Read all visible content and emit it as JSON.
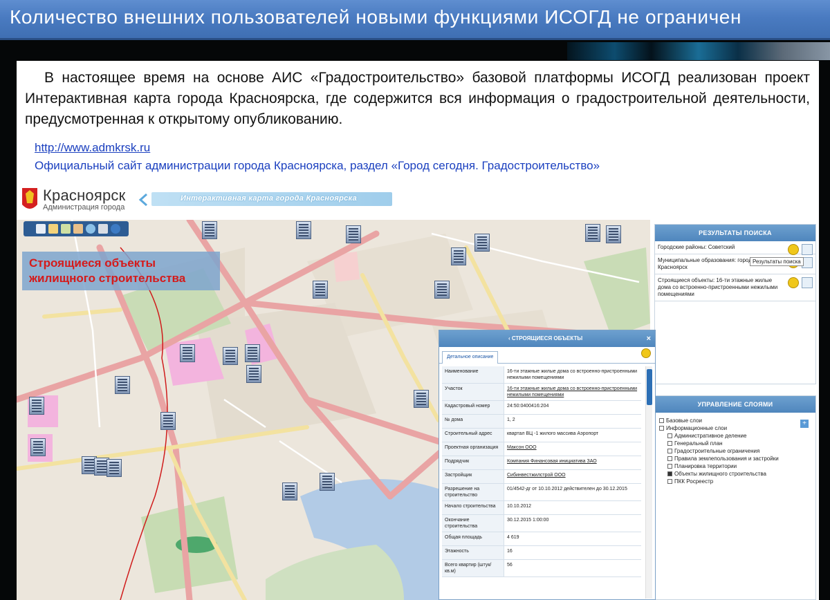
{
  "slide": {
    "title": "Количество внешних пользователей новыми функциями ИСОГД не ограничен",
    "paragraph": "В настоящее время на основе АИС «Градостроительство» базовой платформы ИСОГД реализован проект Интерактивная карта города Красноярска, где содержится вся информация о градостроительной деятельности, предусмотренная к открытому опубликованию.",
    "link_url": "http://www.admkrsk.ru",
    "link_desc": "Официальный сайт администрации города Красноярска, раздел «Город сегодня. Градостроительство»"
  },
  "app": {
    "brand_city": "Красноярск",
    "brand_sub": "Администрация города",
    "banner": "Интерактивная карта города Красноярска",
    "map_label_line1": "Строящиеся объекты",
    "map_label_line2": "жилищного строительства",
    "toolbar_icons": [
      "search-icon",
      "layers-icon",
      "edit-icon",
      "ruler-icon",
      "globe-icon",
      "print-icon",
      "help-icon"
    ]
  },
  "results": {
    "header": "РЕЗУЛЬТАТЫ ПОИСКА",
    "items": [
      "Городские районы: Советский",
      "Муниципальные образования: город Красноярск",
      "Строящиеся объекты: 16-ти этажные жилые дома со встроенно-пристроенными нежилыми помещениями"
    ],
    "tooltip": "Результаты поиска"
  },
  "objects": {
    "header": "СТРОЯЩИЕСЯ ОБЪЕКТЫ",
    "close": "×",
    "tab": "Детальное описание",
    "rows": [
      {
        "k": "Наименование",
        "v": "16-ти этажные жилые дома со встроенно-пристроенными нежилыми помещениями",
        "u": false
      },
      {
        "k": "Участок",
        "v": "16-ти этажные жилые дома со встроенно-пристроенными нежилыми помещениями",
        "u": true
      },
      {
        "k": "Кадастровый номер",
        "v": "24:50:0400416:204",
        "u": false
      },
      {
        "k": "№ дома",
        "v": "1, 2",
        "u": false
      },
      {
        "k": "Строительный адрес",
        "v": "квартал ВЦ -1 жилого массива Аэропорт",
        "u": false
      },
      {
        "k": "Проектная организация",
        "v": "Максон ООО",
        "u": true
      },
      {
        "k": "Подрядчик",
        "v": "Компания Финансовая инициатива ЗАО",
        "u": true
      },
      {
        "k": "Застройщик",
        "v": "Сибинвестжилстрой ООО",
        "u": true
      },
      {
        "k": "Разрешение на строительство",
        "v": "01/4542-дг от 10.10.2012 действителен до 30.12.2015",
        "u": false
      },
      {
        "k": "Начало строительства",
        "v": "10.10.2012",
        "u": false
      },
      {
        "k": "Окончание строительства",
        "v": "30.12.2015 1:00:00",
        "u": false
      },
      {
        "k": "Общая площадь",
        "v": "4 619",
        "u": false
      },
      {
        "k": "Этажность",
        "v": "16",
        "u": false
      },
      {
        "k": "Всего квартир (штук/кв.м)",
        "v": "56",
        "u": false
      }
    ]
  },
  "layers": {
    "header": "УПРАВЛЕНИЕ СЛОЯМИ",
    "add": "+",
    "groups": [
      {
        "label": "Базовые слои",
        "indent": false,
        "mark": "plus"
      },
      {
        "label": "Информационные слои",
        "indent": false,
        "mark": "minus"
      },
      {
        "label": "Административное деление",
        "indent": true,
        "mark": "plus"
      },
      {
        "label": "Генеральный план",
        "indent": true,
        "mark": "plus"
      },
      {
        "label": "Градостроительные ограничения",
        "indent": true,
        "mark": "plus"
      },
      {
        "label": "Правила землепользования и застройки",
        "indent": true,
        "mark": "plus"
      },
      {
        "label": "Планировка территории",
        "indent": true,
        "mark": "plus"
      },
      {
        "label": "Объекты жилищного строительства",
        "indent": true,
        "mark": "check"
      },
      {
        "label": "ПКК Росреестр",
        "indent": true,
        "mark": "plus"
      }
    ]
  },
  "colors": {
    "title_bar": "#4a7bc1",
    "map_bg": "#ece6dc",
    "road": "#e9a4a4",
    "river": "#b2cbe6",
    "park": "#bcd9a8",
    "label_text": "#d51a1a"
  }
}
